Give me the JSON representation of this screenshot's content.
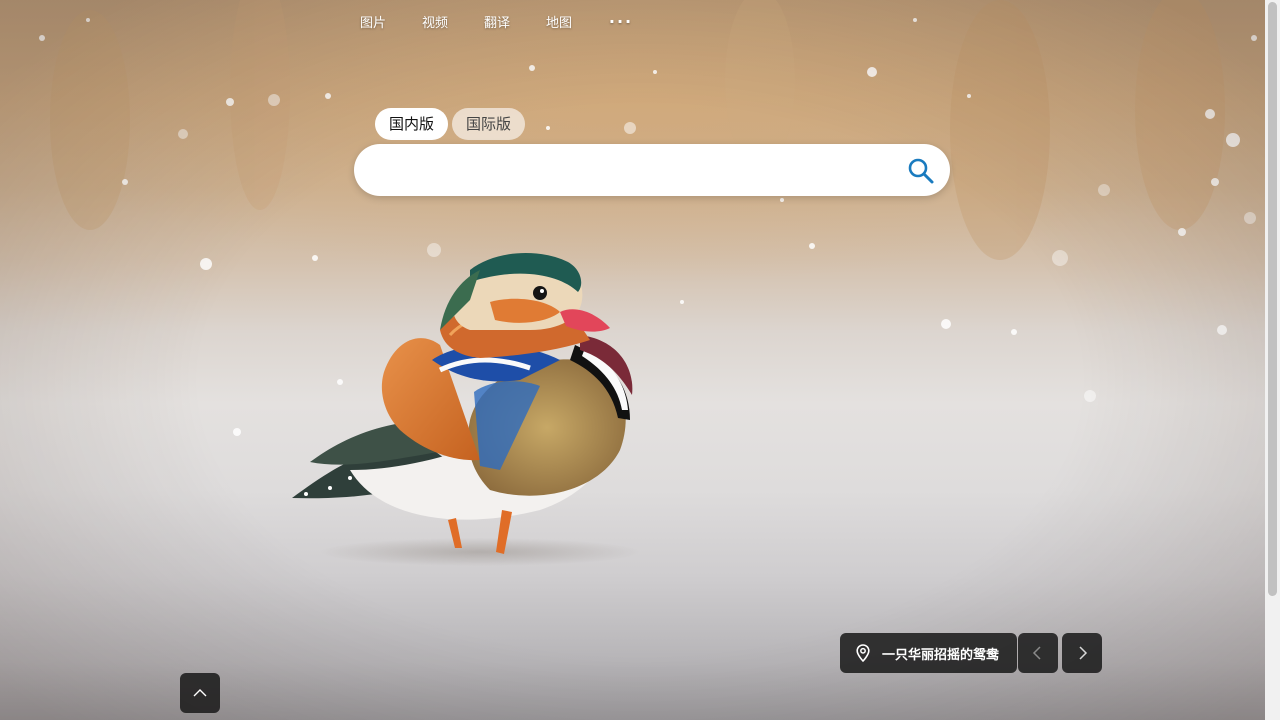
{
  "nav": {
    "items": [
      "图片",
      "视频",
      "翻译",
      "地图"
    ],
    "more": "···"
  },
  "tabs": {
    "domestic": "国内版",
    "international": "国际版",
    "active": "国内版"
  },
  "search": {
    "value": "",
    "placeholder": ""
  },
  "caption": {
    "text": "一只华丽招摇的鸳鸯"
  },
  "icons": {
    "search": "search-icon",
    "location": "location-pin-icon",
    "prev": "chevron-left-icon",
    "next": "chevron-right-icon",
    "scroll_top": "chevron-up-icon"
  },
  "colors": {
    "search_icon": "#1a7bbf",
    "overlay_dark": "#1c1c1c"
  }
}
